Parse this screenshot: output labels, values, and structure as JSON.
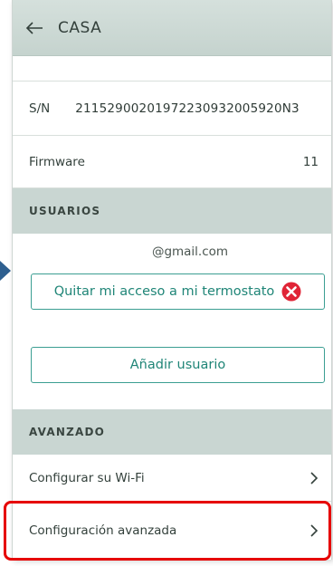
{
  "header": {
    "title": "CASA",
    "back_icon": "arrow-left-icon"
  },
  "device_info": {
    "serial": {
      "label": "S/N",
      "value": "21152900201972230932005920N3"
    },
    "firmware": {
      "label": "Firmware",
      "value": "11"
    }
  },
  "users": {
    "section_title": "USUARIOS",
    "email": "@gmail.com",
    "remove_access_label": "Quitar mi acceso a mi termostato",
    "remove_icon": "close-circle-icon",
    "add_user_label": "Añadir usuario"
  },
  "advanced": {
    "section_title": "AVANZADO",
    "items": [
      {
        "label": "Configurar su Wi-Fi",
        "icon": "chevron-right-icon"
      },
      {
        "label": "Configuración avanzada",
        "icon": "chevron-right-icon"
      }
    ]
  },
  "colors": {
    "header_bg": "#c5d3ce",
    "section_bg": "#c9d6d2",
    "accent": "#3b9e92",
    "remove_icon": "#e02436",
    "highlight": "#e60000",
    "pointer": "#2e5f8f"
  }
}
